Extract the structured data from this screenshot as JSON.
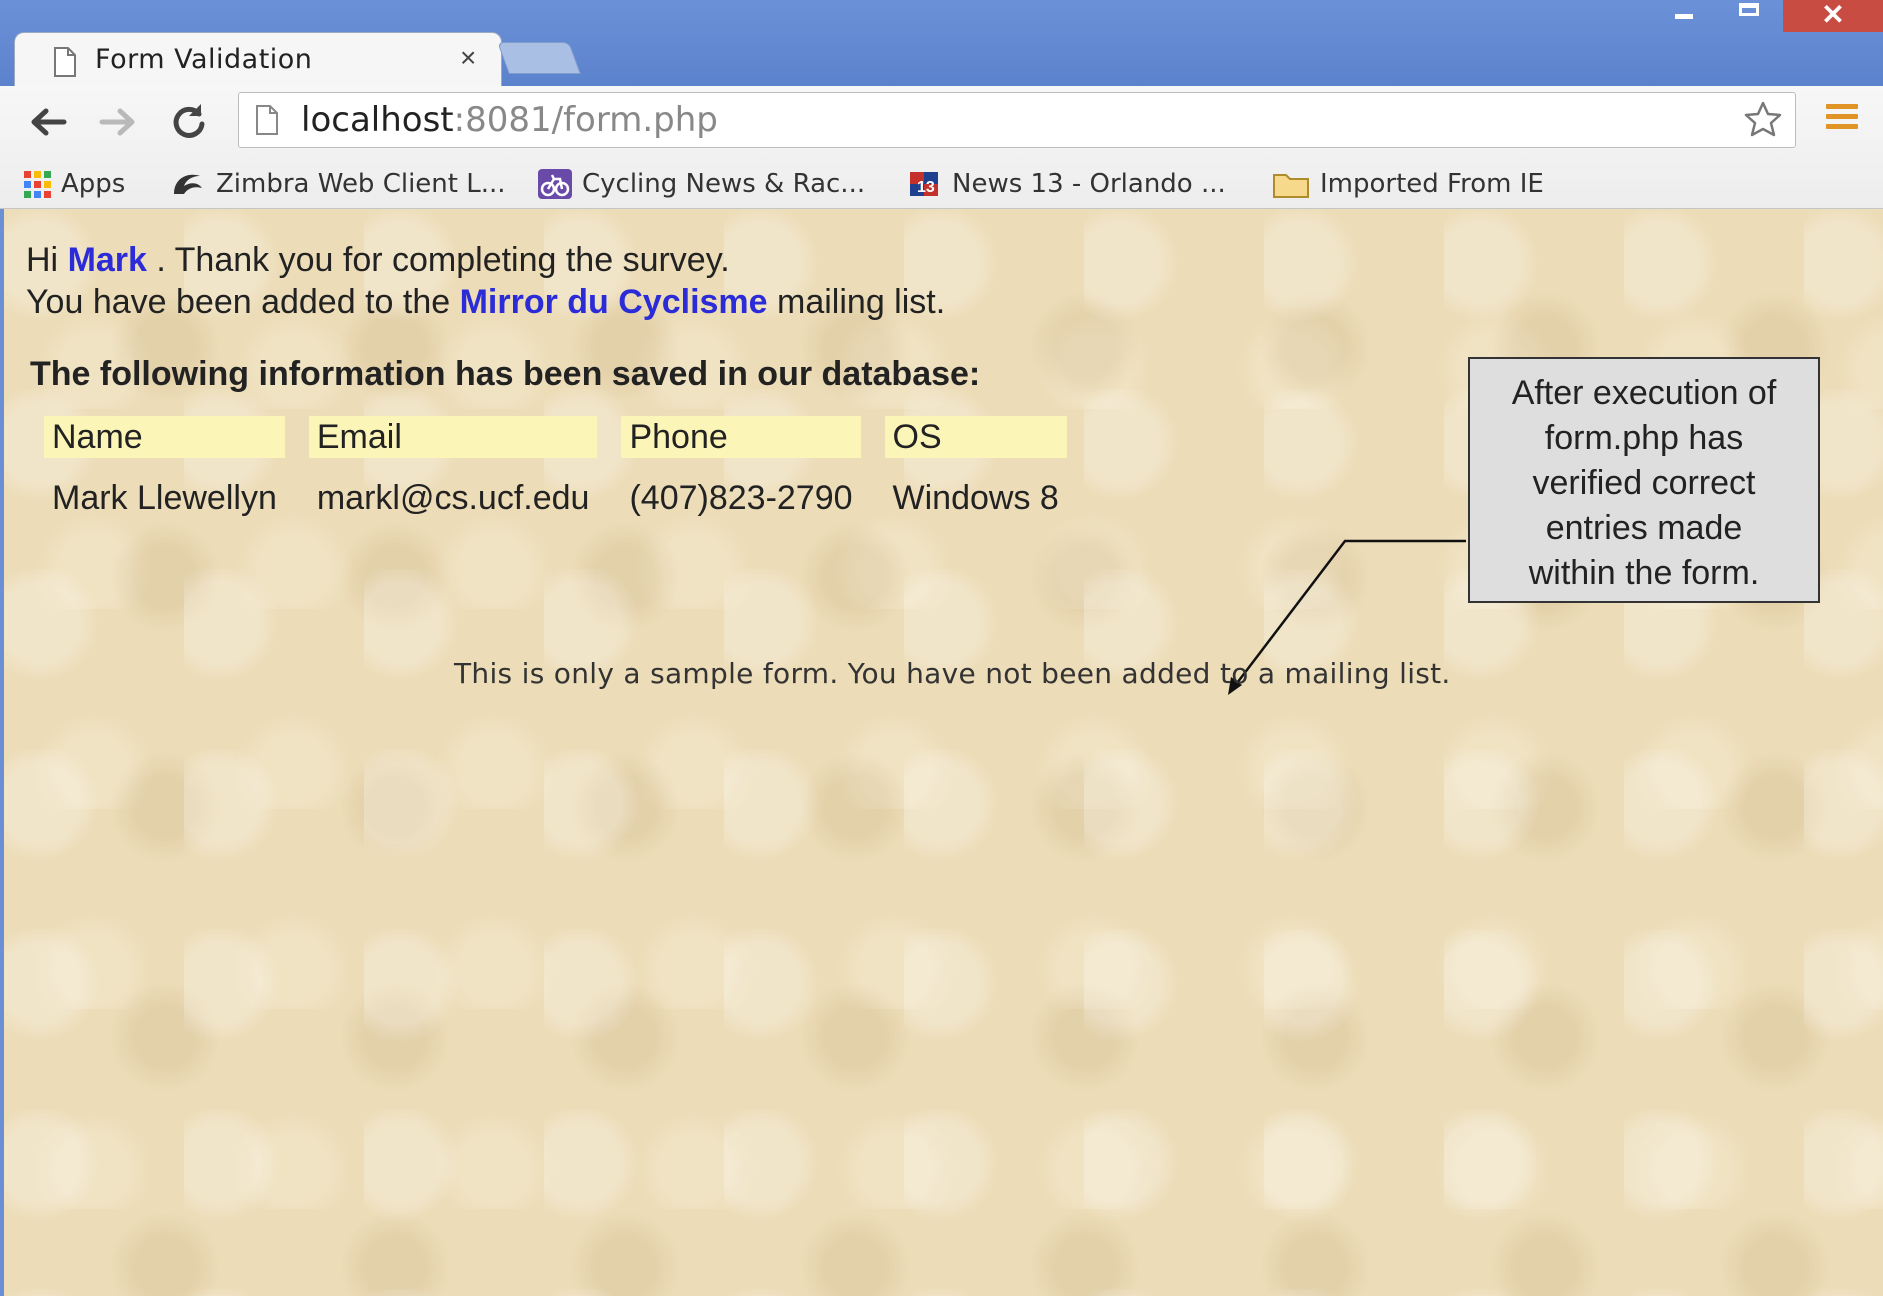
{
  "browser": {
    "tab_title": "Form Validation",
    "tab_close": "×",
    "close_symbol": "✕",
    "url_host": "localhost",
    "url_rest": ":8081/form.php"
  },
  "bookmarks": [
    {
      "label": "Apps",
      "icon": "apps-grid-icon"
    },
    {
      "label": "Zimbra Web Client L...",
      "icon": "zimbra-icon"
    },
    {
      "label": "Cycling News & Rac...",
      "icon": "cycling-icon"
    },
    {
      "label": "News 13 - Orlando ...",
      "icon": "news13-icon"
    },
    {
      "label": "Imported From IE",
      "icon": "folder-icon"
    }
  ],
  "page": {
    "hi": "Hi ",
    "name": "Mark",
    "thanks": " . Thank you for completing the survey.",
    "added_prefix": "You have been added to the ",
    "list_name": "Mirror du Cyclisme",
    "added_suffix": " mailing list.",
    "saved_heading": "The following information has been saved in our database:",
    "table": {
      "headers": [
        "Name",
        "Email",
        "Phone",
        "OS"
      ],
      "row": [
        "Mark Llewellyn",
        "markl@cs.ucf.edu",
        "(407)823-2790",
        "Windows 8"
      ]
    },
    "note": "This is only a sample form. You have not been added to a mailing list."
  },
  "callout": {
    "lines": [
      "After execution of",
      "form.php has",
      "verified correct",
      "entries made",
      "within the form."
    ]
  },
  "colors": {
    "highlight": "#2b2bd8",
    "header_bg": "#fbf5b8",
    "page_bg": "#ecdcb7",
    "menu": "#e09426"
  }
}
